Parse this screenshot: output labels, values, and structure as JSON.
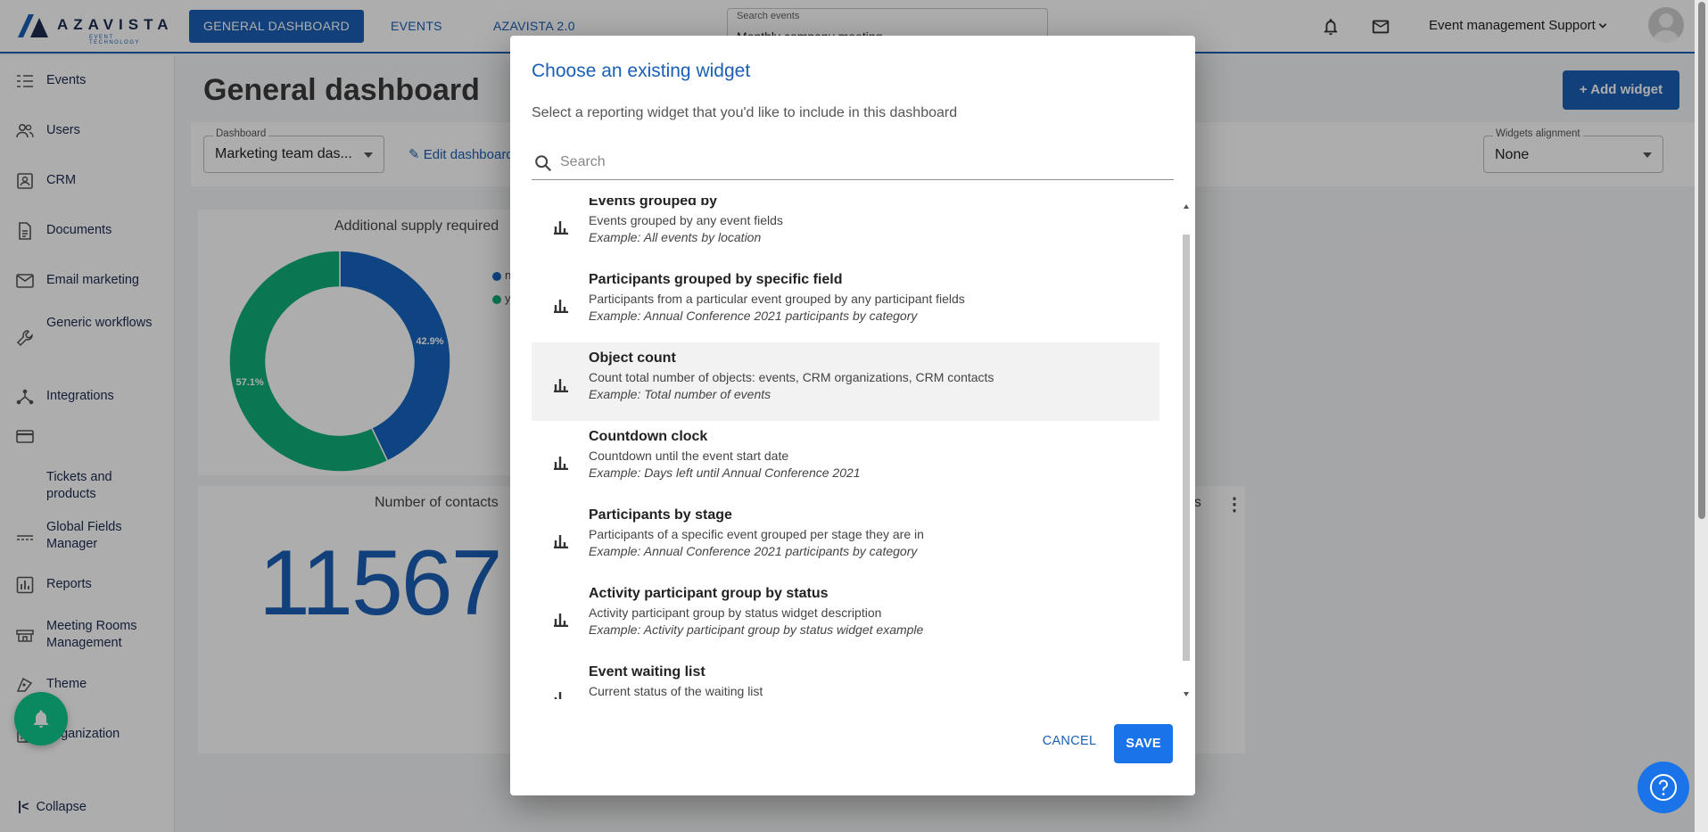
{
  "app": {
    "logo_text": "AZAVISTA",
    "logo_sub": "EVENT TECHNOLOGY"
  },
  "topnav": {
    "tabs": [
      {
        "label": "GENERAL DASHBOARD",
        "active": true
      },
      {
        "label": "EVENTS",
        "active": false
      },
      {
        "label": "AZAVISTA 2.0",
        "active": false
      }
    ],
    "search_label": "Search events",
    "search_value": "Monthly company meeting",
    "user_name": "Event management Support",
    "icons": [
      "bell-icon",
      "mail-icon",
      "chevron-down-icon",
      "user-avatar-icon"
    ]
  },
  "sidebar": {
    "items": [
      {
        "label": "Events",
        "icon": "list-icon"
      },
      {
        "label": "Users",
        "icon": "users-icon"
      },
      {
        "label": "CRM",
        "icon": "crm-icon"
      },
      {
        "label": "Documents",
        "icon": "document-icon"
      },
      {
        "label": "Email marketing",
        "icon": "mail-icon"
      },
      {
        "label": "Generic workflows",
        "icon": "wrench-icon"
      },
      {
        "label": "Integrations",
        "icon": "integrations-icon"
      },
      {
        "label": "Tickets and products",
        "icon": "card-icon"
      },
      {
        "label": "Global Fields Manager",
        "icon": "fields-icon"
      },
      {
        "label": "Reports",
        "icon": "bar-chart-icon"
      },
      {
        "label": "Meeting Rooms Management",
        "icon": "room-icon"
      },
      {
        "label": "Theme",
        "icon": "theme-icon"
      },
      {
        "label": "Organization",
        "icon": "building-icon"
      }
    ],
    "collapse_label": "Collapse"
  },
  "dashboard": {
    "title": "General dashboard",
    "add_widget_label": "Add widget",
    "dashboard_select": {
      "label": "Dashboard",
      "value": "Marketing team das..."
    },
    "edit_label": "Edit dashboard",
    "alignment_select": {
      "label": "Widgets alignment",
      "value": "None"
    },
    "donut_card": {
      "title": "Additional supply required",
      "legend_partial": [
        "n",
        "y"
      ]
    },
    "contacts_card": {
      "title": "Number of contacts",
      "value": "11567"
    },
    "third_card_title_partial": "ns"
  },
  "chart_data": {
    "type": "pie",
    "title": "Additional supply required",
    "slices": [
      {
        "label": "n",
        "value": 42.9,
        "value_label": "42.9%",
        "color": "#1565c0"
      },
      {
        "label": "y",
        "value": 57.1,
        "value_label": "57.1%",
        "color": "#0fb07a"
      }
    ]
  },
  "modal": {
    "title": "Choose an existing widget",
    "subtitle": "Select a reporting widget that you'd like to include in this dashboard",
    "search_placeholder": "Search",
    "widgets": [
      {
        "title": "Events grouped by",
        "description": "Events grouped by any event fields",
        "example": "Example: All events by location",
        "highlighted": false
      },
      {
        "title": "Participants grouped by specific field",
        "description": "Participants from a particular event grouped by any participant fields",
        "example": "Example: Annual Conference 2021 participants by category",
        "highlighted": false
      },
      {
        "title": "Object count",
        "description": "Count total number of objects: events, CRM organizations, CRM contacts",
        "example": "Example: Total number of events",
        "highlighted": true
      },
      {
        "title": "Countdown clock",
        "description": "Countdown until the event start date",
        "example": "Example: Days left until Annual Conference 2021",
        "highlighted": false
      },
      {
        "title": "Participants by stage",
        "description": "Participants of a specific event grouped per stage they are in",
        "example": "Example: Annual Conference 2021 participants by category",
        "highlighted": false
      },
      {
        "title": "Activity participant group by status",
        "description": "Activity participant group by status widget description",
        "example": "Example: Activity participant group by status widget example",
        "highlighted": false
      },
      {
        "title": "Event waiting list",
        "description": "Current status of the waiting list",
        "example": "",
        "highlighted": false
      }
    ],
    "cancel_label": "CANCEL",
    "save_label": "SAVE"
  },
  "colors": {
    "primary": "#1a5fb4",
    "button_blue": "#1a73e8",
    "donut_blue": "#1565c0",
    "donut_green": "#0fb07a",
    "fab_green": "#10c98c"
  }
}
